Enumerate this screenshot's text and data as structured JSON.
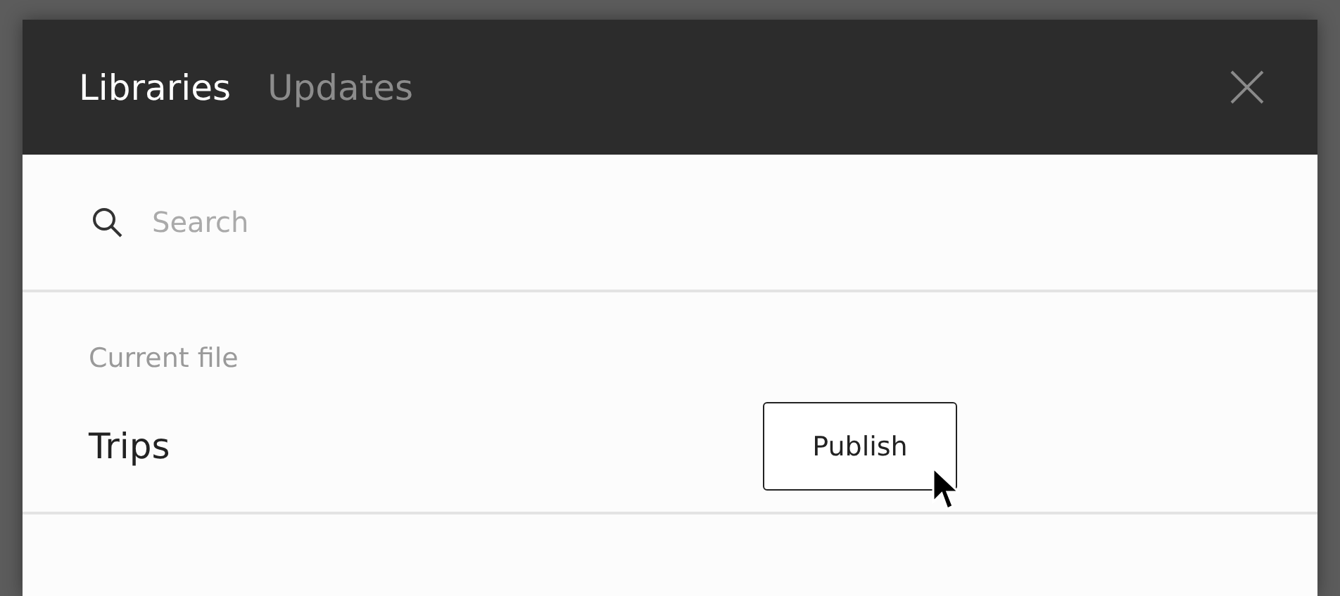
{
  "tabs": [
    {
      "label": "Libraries",
      "selected": true
    },
    {
      "label": "Updates",
      "selected": false
    }
  ],
  "search": {
    "placeholder": "Search"
  },
  "section": {
    "heading": "Current file",
    "file_name": "Trips",
    "button": "Publish"
  }
}
